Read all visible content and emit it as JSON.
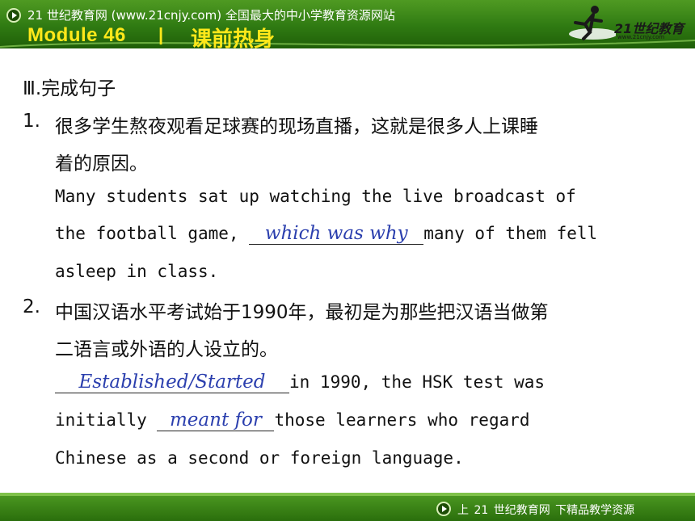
{
  "header": {
    "site_title": "21 世纪教育网 (www.21cnjy.com)  全国最大的中小学教育资源网站",
    "module": "Module 46",
    "separator": "|",
    "section": "课前热身",
    "logo_text": "21世纪教育",
    "logo_url": "www.21cnjy.com"
  },
  "exercise": {
    "heading": "Ⅲ.完成句子",
    "items": [
      {
        "number": "1.",
        "chinese_line1": "很多学生熬夜观看足球赛的现场直播，这就是很多人上课睡",
        "chinese_line2": "着的原因。",
        "english_line1": "Many students sat up watching the live broadcast of",
        "english_before_blank": "the football game, ",
        "answer": "which was why",
        "english_after_blank": "many of them fell",
        "english_line3": "asleep in class."
      },
      {
        "number": "2.",
        "chinese_line1": "中国汉语水平考试始于1990年，最初是为那些把汉语当做第",
        "chinese_line2": "二语言或外语的人设立的。",
        "answer1": "Established/Started",
        "english_after_blank1": "in 1990, the HSK test was",
        "english_before_blank2": "initially ",
        "answer2": "meant for",
        "english_after_blank2": "those learners who regard",
        "english_line3": "Chinese as a second or foreign language."
      }
    ]
  },
  "footer": {
    "text": "上 21 世纪教育网   下精品教学资源"
  },
  "colors": {
    "header_green": "#2f7a12",
    "title_yellow": "#ffe81a",
    "answer_blue": "#2b3fae"
  }
}
